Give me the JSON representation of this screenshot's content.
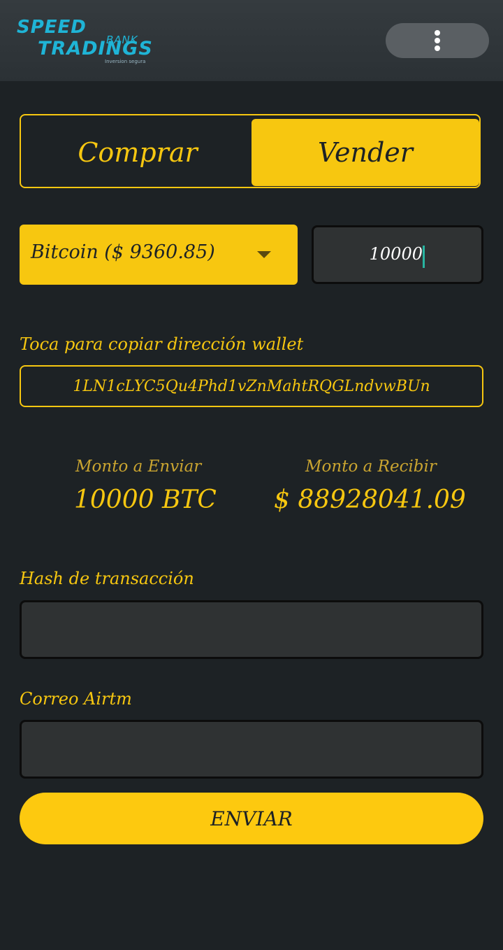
{
  "header": {
    "logo": {
      "line1": "SPEED",
      "line2": "BANK",
      "line3": "TRADINGS",
      "tagline": "Inversion segura"
    },
    "menu_icon": "more-vertical-icon"
  },
  "trade_toggle": {
    "buy_label": "Comprar",
    "sell_label": "Vender",
    "selected": "Vender"
  },
  "crypto_select": {
    "selected_label": "Bitcoin ($ 9360.85)"
  },
  "amount_input": {
    "value": "10000"
  },
  "wallet": {
    "label": "Toca para copiar dirección wallet",
    "address": "1LN1cLYC5Qu4Phd1vZnMahtRQGLndvwBUn"
  },
  "summary": {
    "send_label": "Monto a Enviar",
    "send_value": "10000 BTC",
    "receive_label": "Monto a Recibir",
    "receive_value": "$ 88928041.09"
  },
  "hash_field": {
    "label": "Hash de transacción",
    "value": ""
  },
  "email_field": {
    "label": "Correo Airtm",
    "value": ""
  },
  "submit": {
    "label": "ENVIAR"
  },
  "colors": {
    "accent": "#f7c710",
    "background": "#1d2225",
    "input_background": "#2f3233",
    "header_background": "#33393d",
    "logo": "#1fb4d6"
  }
}
